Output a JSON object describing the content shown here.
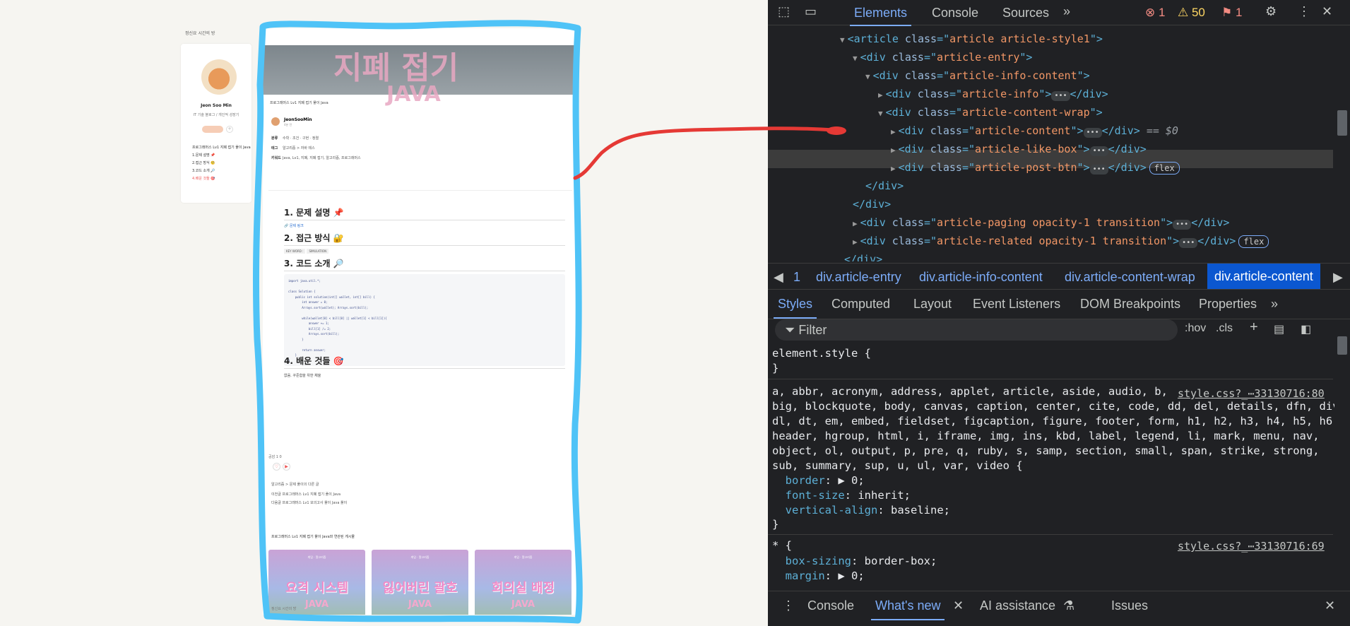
{
  "blog": {
    "small_title": "정신요 시간의 방",
    "profile_name": "Jeon Soo Min",
    "profile_desc": "IT 기술 블로그 / 개인적 성장기",
    "toc": [
      "프로그래머스 Lv1 지폐 접기 풀이 Java",
      "1.문제 설명 📌",
      "2.접근 방식 🧐",
      "3.코드 소개 🔎",
      "4.배운 것들 🎯"
    ]
  },
  "article": {
    "hero_line1": "지폐 접기",
    "hero_line2": "JAVA",
    "breadcrumb": "프로그래머스 Lv1 지폐 접기 풀이 Java",
    "author": "JeonSooMin",
    "author_sub": "4분 전",
    "meta": [
      {
        "label": "분류",
        "value": "수학 · 조건 · 구현 · 정렬"
      },
      {
        "label": "태그",
        "value": "알고리즘 > 자바 테스"
      },
      {
        "label": "키워드",
        "value": "Java, Lv1, 지폐, 지폐 접기, 알고리즘, 프로그래머스"
      }
    ],
    "h1": "1. 문제 설명 📌",
    "problem_link": "🔗 문제 링크",
    "h2": "2. 접근 방식 🔐",
    "chips": [
      "KEY WORD :",
      "SIMULATION"
    ],
    "h3": "3. 코드 소개 🔎",
    "code": "import java.util.*;\n\nclass Solution {\n    public int solution(int[] wallet, int[] bill) {\n        int answer = 0;\n        Arrays.sort(wallet); Arrays.sort(bill);\n\n        while(wallet[0] < bill[0] || wallet[1] < bill[1]){\n            answer += 1;\n            bill[1] /= 2;\n            Arrays.sort(bill);\n        }\n\n        return answer;\n    }\n}",
    "h4": "4. 배운 것들 🎯",
    "learned": "없음. 꾸준함을 위한 채울",
    "like_label": "공감 1 0",
    "category_title": "알고리즘 > 문제 풀이의 다른 글",
    "category_rows": [
      "이전글   프로그래머스 Lv1 지폐 접기 풀이 Java",
      "다음글   프로그래머스 Lv1 모의고사 풀이 Java 풀이"
    ],
    "related_title": "프로그래머스 Lv1 지폐 접기 풀이 Java와 연관된 게시물",
    "related": [
      {
        "title": "요격 시스템",
        "sub": "JAVA",
        "tag": "게임 · 알고리즘"
      },
      {
        "title": "잃어버린 괄호",
        "sub": "JAVA",
        "tag": "게임 · 알고리즘"
      },
      {
        "title": "회의실 배정",
        "sub": "JAVA",
        "tag": "게임 · 알고리즘"
      }
    ],
    "footer": "정신요 시간의 방"
  },
  "devtools": {
    "tabs": [
      "Elements",
      "Console",
      "Sources"
    ],
    "errors": "1",
    "warnings": "50",
    "issues": "1",
    "tree": [
      {
        "indent": 0,
        "open": true,
        "tag": "article",
        "attr": "class",
        "val": "article article-style1",
        "close": false
      },
      {
        "indent": 1,
        "open": true,
        "tag": "div",
        "attr": "class",
        "val": "article-entry",
        "close": false
      },
      {
        "indent": 2,
        "open": true,
        "tag": "div",
        "attr": "class",
        "val": "article-info-content",
        "close": false
      },
      {
        "indent": 3,
        "open": false,
        "tag": "div",
        "attr": "class",
        "val": "article-info",
        "close": true
      },
      {
        "indent": 3,
        "open": true,
        "tag": "div",
        "attr": "class",
        "val": "article-content-wrap",
        "close": false
      },
      {
        "indent": 4,
        "open": false,
        "tag": "div",
        "attr": "class",
        "val": "article-content",
        "close": true,
        "selected": true
      },
      {
        "indent": 4,
        "open": false,
        "tag": "div",
        "attr": "class",
        "val": "article-like-box",
        "close": true
      },
      {
        "indent": 4,
        "open": false,
        "tag": "div",
        "attr": "class",
        "val": "article-post-btn",
        "close": true,
        "flex": true
      }
    ],
    "selected_suffix": "== $0",
    "flex_label": "flex",
    "closing": [
      "</div>",
      "</div>"
    ],
    "tree_tail": [
      {
        "tag": "div",
        "attr": "class",
        "val": "article-paging opacity-1 transition"
      },
      {
        "tag": "div",
        "attr": "class",
        "val": "article-related opacity-1 transition"
      }
    ],
    "tree_end": "</div>",
    "breadcrumbs": [
      "1",
      "div.article-entry",
      "div.article-info-content",
      "div.article-content-wrap",
      "div.article-content"
    ],
    "style_tabs": [
      "Styles",
      "Computed",
      "Layout",
      "Event Listeners",
      "DOM Breakpoints",
      "Properties"
    ],
    "filter_placeholder": "Filter",
    "hov": ":hov",
    "cls": ".cls",
    "element_style": "element.style {",
    "close_brace": "}",
    "reset_selector": "a, abbr, acronym, address, applet, article, aside, audio, b,\nbig, blockquote, body, canvas, caption, center, cite, code, dd, del, details, dfn, div,\ndl, dt, em, embed, fieldset, figcaption, figure, footer, form, h1, h2, h3, h4, h5, h6,\nheader, hgroup, html, i, iframe, img, ins, kbd, label, legend, li, mark, menu, nav,\nobject, ol, output, p, pre, q, ruby, s, samp, section, small, span, strike, strong,\nsub, summary, sup, u, ul, var, video {",
    "reset_props": [
      {
        "prop": "border",
        "val": "▶ 0;"
      },
      {
        "prop": "font-size",
        "val": "inherit;"
      },
      {
        "prop": "vertical-align",
        "val": "baseline;"
      }
    ],
    "src1": "style.css?_⋯33130716:80",
    "universal_selector": "* {",
    "src2": "style.css?_⋯33130716:69",
    "universal_props": [
      {
        "prop": "box-sizing",
        "val": "border-box;"
      },
      {
        "prop": "margin",
        "val": "▶ 0;"
      }
    ],
    "drawer_tabs": [
      "Console",
      "What's new",
      "AI assistance",
      "Issues"
    ]
  },
  "colors": {
    "highlight": "#4fc3f7",
    "arrow": "#e53935",
    "accent": "#7cacf8"
  }
}
